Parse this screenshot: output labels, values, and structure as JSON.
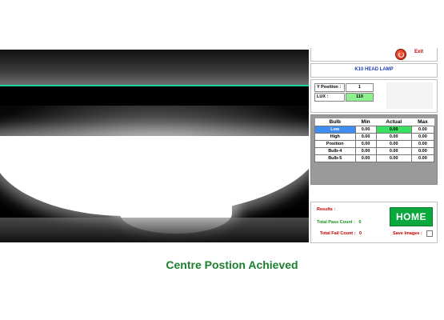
{
  "header": {
    "exit_label": "Exit",
    "model_title": "K10 HEAD LAMP"
  },
  "position": {
    "y_label": "Y Position :",
    "y_value": "1",
    "lux_label": "LUX :",
    "lux_value": "110",
    "lux_color": "#8ff08f"
  },
  "bulb_table": {
    "headers": [
      "Bulb",
      "Min",
      "Actual",
      "Max"
    ],
    "rows": [
      {
        "bulb": "Low",
        "min": "0.00",
        "actual": "0.00",
        "max": "0.00"
      },
      {
        "bulb": "High",
        "min": "0.00",
        "actual": "0.00",
        "max": "0.00"
      },
      {
        "bulb": "Position",
        "min": "0.00",
        "actual": "0.00",
        "max": "0.00"
      },
      {
        "bulb": "Bulb-4",
        "min": "0.00",
        "actual": "0.00",
        "max": "0.00"
      },
      {
        "bulb": "Bulb-5",
        "min": "0.00",
        "actual": "0.00",
        "max": "0.00"
      }
    ]
  },
  "results": {
    "title": "Results :",
    "pass_label": "Total Pass Count :",
    "pass_value": "0",
    "fail_label": "Total Fail Count :",
    "fail_value": "0",
    "home_label": "HOME",
    "save_images_label": "Save Images :"
  },
  "status_message": "Centre Postion Achieved",
  "icons": {
    "exit": "power-icon"
  },
  "colors": {
    "accent_green": "#0aa83d",
    "line": "#15d6a0",
    "selected_row": "#3f8df0"
  }
}
